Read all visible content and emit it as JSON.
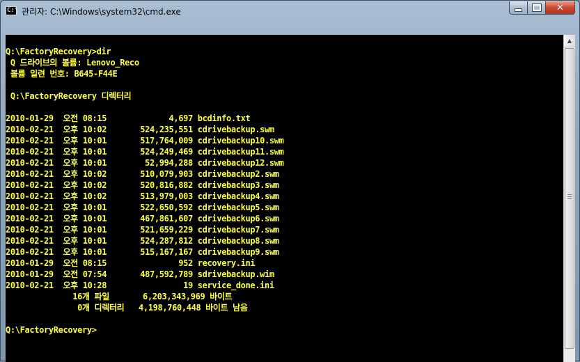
{
  "window": {
    "title": "관리자: C:\\Windows\\system32\\cmd.exe",
    "icon": "cmd-icon",
    "icon_text": "C:\\",
    "caption_buttons": {
      "minimize": "minimize-icon",
      "maximize": "maximize-icon",
      "close": "close-icon"
    }
  },
  "colors": {
    "console_background": "#000000",
    "console_text": "#ffff3c",
    "close_button": "#c7472f"
  },
  "console": {
    "lines": [
      "",
      "Q:\\FactoryRecovery>dir",
      " Q 드라이브의 볼륨: Lenovo_Reco",
      " 볼륨 일련 번호: B645-F44E",
      "",
      " Q:\\FactoryRecovery 디렉터리",
      "",
      "2010-01-29  오전 08:15             4,697 bcdinfo.txt",
      "2010-02-21  오후 10:02       524,235,551 cdrivebackup.swm",
      "2010-02-21  오후 10:01       517,764,009 cdrivebackup10.swm",
      "2010-02-21  오후 10:01       524,249,469 cdrivebackup11.swm",
      "2010-02-21  오후 10:01        52,994,288 cdrivebackup12.swm",
      "2010-02-21  오후 10:02       510,079,903 cdrivebackup2.swm",
      "2010-02-21  오후 10:02       520,816,882 cdrivebackup3.swm",
      "2010-02-21  오후 10:02       513,979,003 cdrivebackup4.swm",
      "2010-02-21  오후 10:01       522,650,592 cdrivebackup5.swm",
      "2010-02-21  오후 10:01       467,861,607 cdrivebackup6.swm",
      "2010-02-21  오후 10:01       521,659,229 cdrivebackup7.swm",
      "2010-02-21  오후 10:01       524,287,812 cdrivebackup8.swm",
      "2010-02-21  오후 10:01       515,167,167 cdrivebackup9.swm",
      "2010-01-29  오전 08:15               952 recovery.ini",
      "2010-01-29  오전 07:54       487,592,789 sdrivebackup.wim",
      "2010-02-21  오후 10:28                19 service_done.ini",
      "              16개 파일       6,203,343,969 바이트",
      "               0개 디렉터리   4,198,760,448 바이트 남음",
      "",
      "Q:\\FactoryRecovery>"
    ]
  },
  "scrollbar": {
    "up_arrow": "▲"
  }
}
